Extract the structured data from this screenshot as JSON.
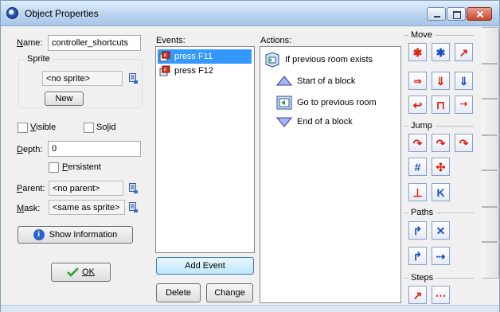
{
  "window": {
    "title": "Object Properties"
  },
  "name": {
    "label": "Name:",
    "value": "controller_shortcuts"
  },
  "sprite": {
    "legend": "Sprite",
    "value": "<no sprite>",
    "new_label": "New"
  },
  "checks": {
    "visible": "Visible",
    "solid": "Solid",
    "persistent": "Persistent"
  },
  "depth": {
    "label": "Depth:",
    "value": "0"
  },
  "parent": {
    "label": "Parent:",
    "value": "<no parent>"
  },
  "mask": {
    "label": "Mask:",
    "value": "<same as sprite>"
  },
  "buttons": {
    "show_info": "Show Information",
    "ok": "OK",
    "add_event": "Add Event",
    "delete": "Delete",
    "change": "Change"
  },
  "events": {
    "header": "Events:",
    "items": [
      "press F11",
      "press F12"
    ]
  },
  "actions": {
    "header": "Actions:",
    "items": [
      "If previous room exists",
      "Start of a block",
      "Go to previous room",
      "End of a block"
    ]
  },
  "panel": {
    "sections": [
      "Move",
      "Jump",
      "Paths",
      "Steps"
    ]
  },
  "colors": {
    "selection": "#3399ff",
    "tool_red": "#e02010",
    "tool_blue": "#1a4fc4",
    "window_bg": "#f0f0f0"
  },
  "icons": [
    "window-icon",
    "keyboard-event-icon",
    "sprite-picker-icon",
    "info-icon",
    "checkmark-icon"
  ]
}
